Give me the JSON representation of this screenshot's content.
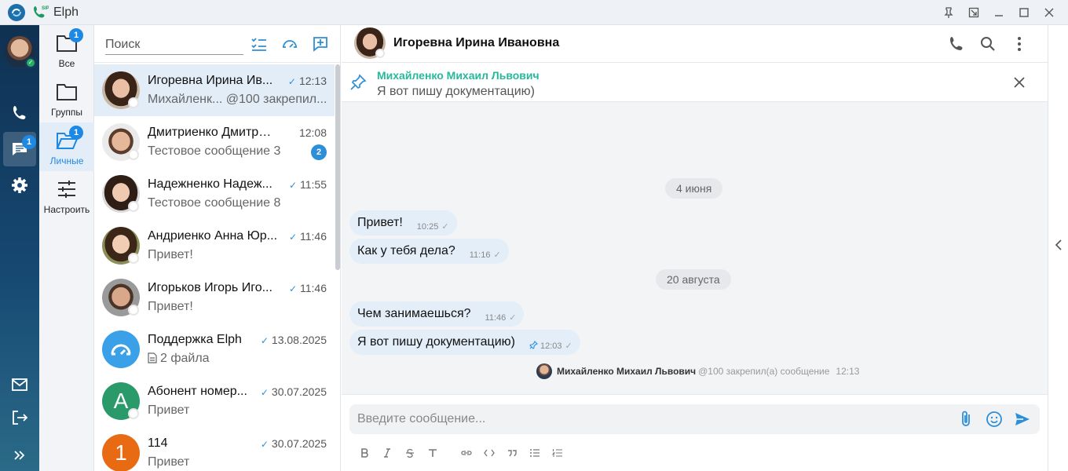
{
  "app": {
    "title": "Elph"
  },
  "rail": {
    "chats_badge": "1"
  },
  "folders": [
    {
      "label": "Все",
      "badge": "1"
    },
    {
      "label": "Группы",
      "badge": ""
    },
    {
      "label": "Личные",
      "badge": "1"
    },
    {
      "label": "Настроить",
      "badge": ""
    }
  ],
  "search": {
    "placeholder": "Поиск"
  },
  "chats": [
    {
      "name": "Игоревна Ирина Ив...",
      "time": "12:13",
      "read": true,
      "preview": "Михайленк... @100 закрепил...",
      "unread": "",
      "avatar": "woman1"
    },
    {
      "name": "Дмитриенко Дмитрий ...",
      "time": "12:08",
      "read": false,
      "preview": "Тестовое сообщение 3",
      "unread": "2",
      "avatar": "man1"
    },
    {
      "name": "Надежненко Надеж...",
      "time": "11:55",
      "read": true,
      "preview": "Тестовое сообщение 8",
      "unread": "",
      "avatar": "woman2"
    },
    {
      "name": "Андриенко Анна Юр...",
      "time": "11:46",
      "read": true,
      "preview": "Привет!",
      "unread": "",
      "avatar": "woman3"
    },
    {
      "name": "Игорьков Игорь Иго...",
      "time": "11:46",
      "read": true,
      "preview": "Привет!",
      "unread": "",
      "avatar": "man2"
    },
    {
      "name": "Поддержка Elph",
      "time": "13.08.2025",
      "read": true,
      "preview": "2 файла",
      "unread": "",
      "avatar": "support"
    },
    {
      "name": "Абонент номер...",
      "time": "30.07.2025",
      "read": true,
      "preview": "Привет",
      "unread": "",
      "avatar": "letter-A"
    },
    {
      "name": "114",
      "time": "30.07.2025",
      "read": true,
      "preview": "Привет",
      "unread": "",
      "avatar": "letter-1"
    }
  ],
  "avatar_letters": {
    "A": "A",
    "one": "1"
  },
  "chat": {
    "title": "Игоревна Ирина Ивановна",
    "pinned": {
      "author": "Михайленко Михаил Львович",
      "text": "Я вот пишу документацию)"
    },
    "dates": [
      "4 июня",
      "20 августа"
    ],
    "messages": [
      {
        "text": "Привет!",
        "time": "10:25"
      },
      {
        "text": "Как у тебя дела?",
        "time": "11:16"
      },
      {
        "text": "Чем занимаешься?",
        "time": "11:46"
      },
      {
        "text": "Я вот пишу документацию)",
        "time": "12:03"
      }
    ],
    "system": {
      "who": "Михайленко Михаил Львович",
      "action": "@100 закрепил(а) сообщение",
      "time": "12:13"
    },
    "composer_placeholder": "Введите сообщение..."
  },
  "colors": {
    "accent": "#1e88e5",
    "pin_author": "#26b99a",
    "bubble": "#e3eef9",
    "rail_top": "#0f3152"
  }
}
